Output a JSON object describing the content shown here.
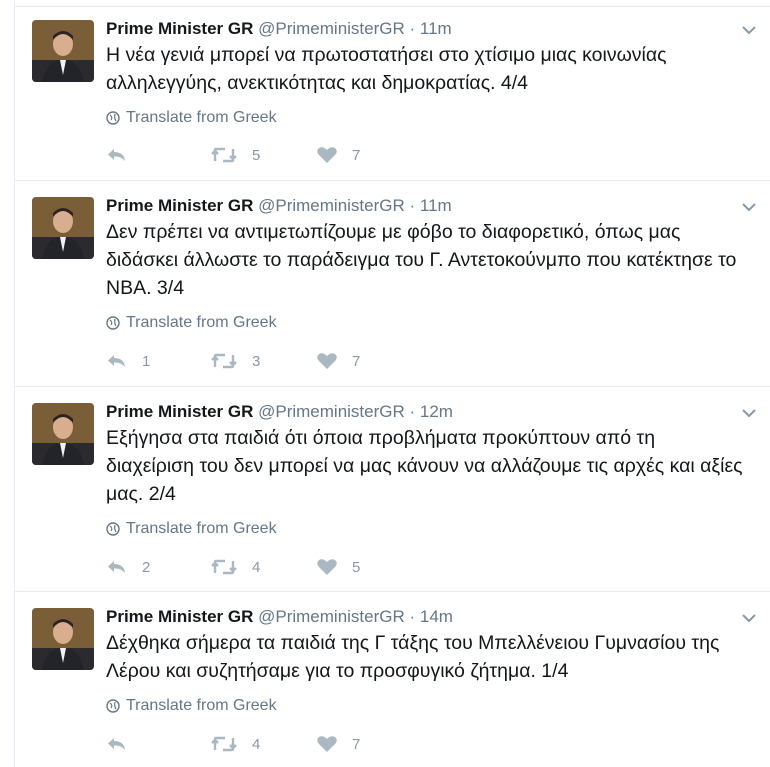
{
  "tweets": [
    {
      "name": "Prime Minister GR",
      "handle": "@PrimeministerGR",
      "time": "11m",
      "text": "Η νέα γενιά μπορεί να πρωτοστατήσει στο χτίσιμο μιας κοινωνίας αλληλεγγύης, ανεκτικότητας και δημοκρατίας. 4/4",
      "translate": "Translate from Greek",
      "reply_count": "",
      "retweet_count": "5",
      "like_count": "7"
    },
    {
      "name": "Prime Minister GR",
      "handle": "@PrimeministerGR",
      "time": "11m",
      "text": "Δεν πρέπει να αντιμετωπίζουμε με φόβο το διαφορετικό, όπως μας διδάσκει άλλωστε το παράδειγμα του Γ. Αντετοκούνμπο που κατέκτησε το NBA. 3/4",
      "translate": "Translate from Greek",
      "reply_count": "1",
      "retweet_count": "3",
      "like_count": "7"
    },
    {
      "name": "Prime Minister GR",
      "handle": "@PrimeministerGR",
      "time": "12m",
      "text": "Εξήγησα στα παιδιά ότι όποια προβλήματα προκύπτουν από τη διαχείριση του δεν μπορεί να μας κάνουν να αλλάζουμε τις αρχές και αξίες μας. 2/4",
      "translate": "Translate from Greek",
      "reply_count": "2",
      "retweet_count": "4",
      "like_count": "5"
    },
    {
      "name": "Prime Minister GR",
      "handle": "@PrimeministerGR",
      "time": "14m",
      "text": "Δέχθηκα σήμερα τα παιδιά της Γ τάξης του Μπελλένειου Γυμνασίου της Λέρου και συζητήσαμε για το προσφυγικό ζήτημα. 1/4",
      "translate": "Translate from Greek",
      "reply_count": "",
      "retweet_count": "4",
      "like_count": "7"
    }
  ],
  "separator": " · ",
  "colors": {
    "text": "#14171a",
    "muted": "#657786",
    "icon": "#aab8c2",
    "border": "#e6ecf0"
  },
  "icons": {
    "reply": "reply-icon",
    "retweet": "retweet-icon",
    "like": "heart-icon",
    "globe": "globe-icon",
    "caret": "chevron-down-icon"
  }
}
